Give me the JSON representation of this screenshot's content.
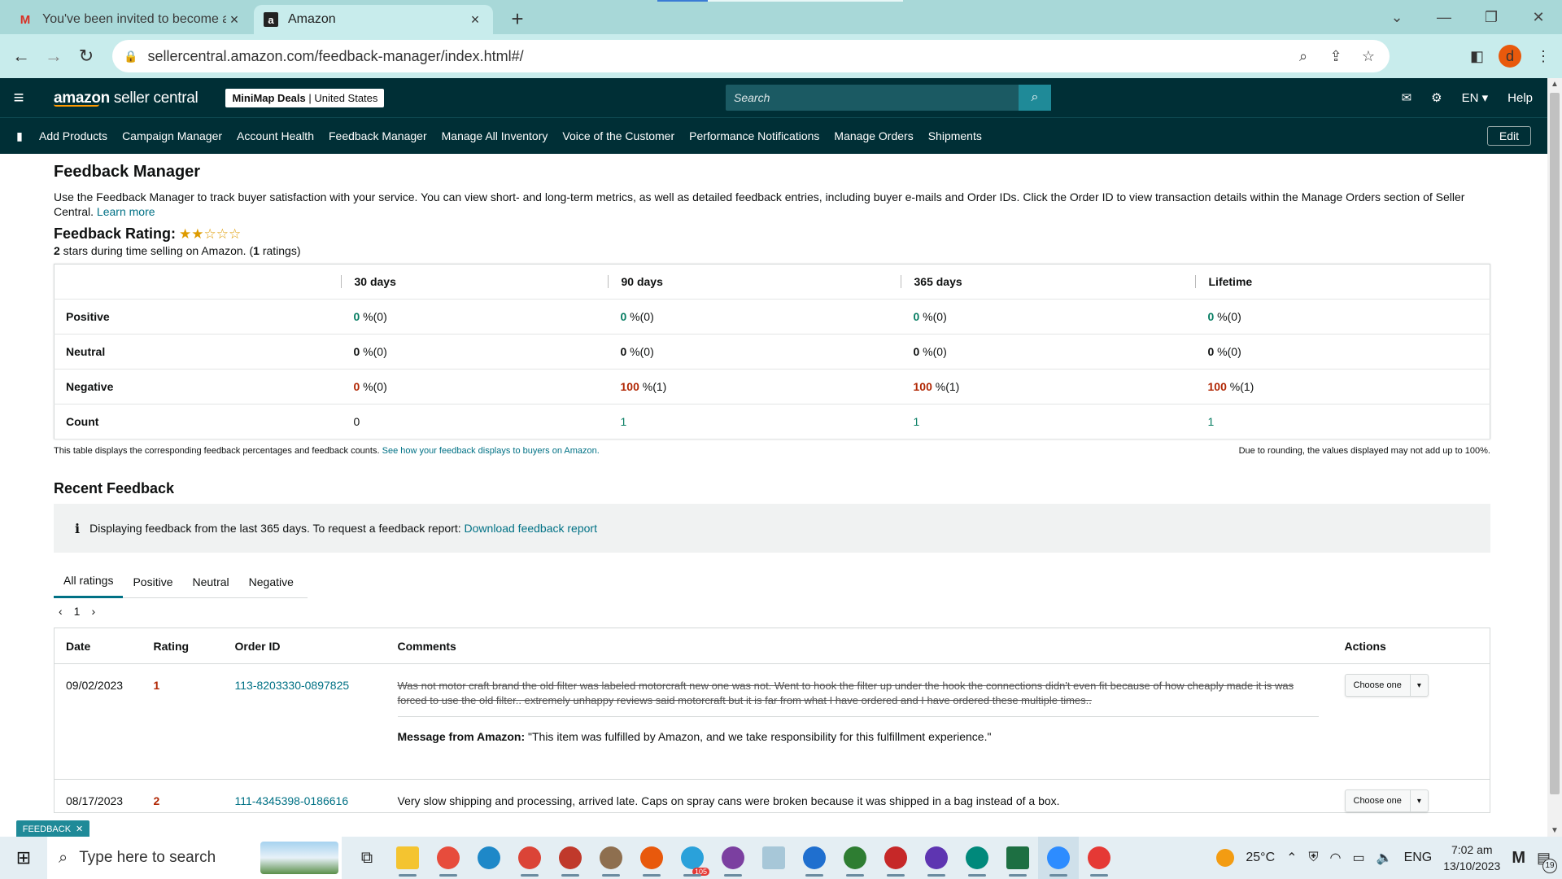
{
  "browser": {
    "tabs": [
      {
        "title": "You've been invited to become a",
        "favicon": "gmail-icon"
      },
      {
        "title": "Amazon",
        "favicon": "amazon-icon"
      }
    ],
    "url": "sellercentral.amazon.com/feedback-manager/index.html#/",
    "profile_initial": "d"
  },
  "header": {
    "logo_brand": "amazon",
    "logo_product": " seller central",
    "store_name": "MiniMap Deals",
    "store_region": " | United States",
    "search_placeholder": "Search",
    "language": "EN",
    "help": "Help"
  },
  "subnav": {
    "items": [
      "Add Products",
      "Campaign Manager",
      "Account Health",
      "Feedback Manager",
      "Manage All Inventory",
      "Voice of the Customer",
      "Performance Notifications",
      "Manage Orders",
      "Shipments"
    ],
    "edit": "Edit"
  },
  "page": {
    "title": "Feedback Manager",
    "description": "Use the Feedback Manager to track buyer satisfaction with your service. You can view short- and long-term metrics, as well as detailed feedback entries, including buyer e-mails and Order IDs. Click the Order ID to view transaction details within the Manage Orders section of Seller Central.",
    "learn_more": "Learn more",
    "rating_label": "Feedback Rating:",
    "rating_stars": 2,
    "rating_max": 5,
    "rating_value": "2",
    "rating_sub_mid": " stars during time selling on Amazon. (",
    "rating_count": "1",
    "rating_sub_end": " ratings)"
  },
  "metrics": {
    "columns": [
      "30 days",
      "90 days",
      "365 days",
      "Lifetime"
    ],
    "rows": {
      "positive": {
        "label": "Positive",
        "cells": [
          {
            "pct": "0",
            "rest": " %(0)"
          },
          {
            "pct": "0",
            "rest": " %(0)"
          },
          {
            "pct": "0",
            "rest": " %(0)"
          },
          {
            "pct": "0",
            "rest": " %(0)"
          }
        ]
      },
      "neutral": {
        "label": "Neutral",
        "cells": [
          {
            "pct": "0",
            "rest": " %(0)"
          },
          {
            "pct": "0",
            "rest": " %(0)"
          },
          {
            "pct": "0",
            "rest": " %(0)"
          },
          {
            "pct": "0",
            "rest": " %(0)"
          }
        ]
      },
      "negative": {
        "label": "Negative",
        "cells": [
          {
            "pct": "0",
            "rest": " %(0)"
          },
          {
            "pct": "100",
            "rest": " %(1)"
          },
          {
            "pct": "100",
            "rest": " %(1)"
          },
          {
            "pct": "100",
            "rest": " %(1)"
          }
        ]
      },
      "count": {
        "label": "Count",
        "cells": [
          "0",
          "1",
          "1",
          "1"
        ]
      }
    },
    "note_left": "This table displays the corresponding feedback percentages and feedback counts.",
    "note_link": "See how your feedback displays to buyers on Amazon.",
    "note_right": "Due to rounding, the values displayed may not add up to 100%."
  },
  "recent": {
    "title": "Recent Feedback",
    "info_text": "Displaying feedback from the last 365 days. To request a feedback report:",
    "info_link": "Download feedback report",
    "filter_tabs": [
      "All ratings",
      "Positive",
      "Neutral",
      "Negative"
    ],
    "page": "1",
    "columns": [
      "Date",
      "Rating",
      "Order ID",
      "Comments",
      "Actions"
    ],
    "rows": [
      {
        "date": "09/02/2023",
        "rating": "1",
        "order_id": "113-8203330-0897825",
        "comment": "Was not motor craft brand the old filter was labeled motorcraft new one was not. Went to hook the filter up under the hook the connections didn't even fit because of how cheaply made it is was forced to use the old filter.. extremely unhappy reviews said motorcraft but it is far from what I have ordered and I have ordered these multiple times..",
        "amazon_label": "Message from Amazon:",
        "amazon_msg": " \"This item was fulfilled by Amazon, and we take responsibility for this fulfillment experience.\"",
        "action": "Choose one"
      },
      {
        "date": "08/17/2023",
        "rating": "2",
        "order_id": "111-4345398-0186616",
        "comment": "Very slow shipping and processing, arrived late. Caps on spray cans were broken because it was shipped in a bag instead of a box.",
        "action": "Choose one"
      }
    ]
  },
  "floating_tag": "FEEDBACK",
  "taskbar": {
    "search_placeholder": "Type here to search",
    "temperature": "25°C",
    "language": "ENG",
    "time": "7:02 am",
    "date": "13/10/2023",
    "notifications": "19",
    "telegram_badge": "105"
  },
  "colors": {
    "header_bg": "#002f36",
    "link": "#007185",
    "positive": "#067d62",
    "negative": "#b12704",
    "star": "#de9b00"
  }
}
